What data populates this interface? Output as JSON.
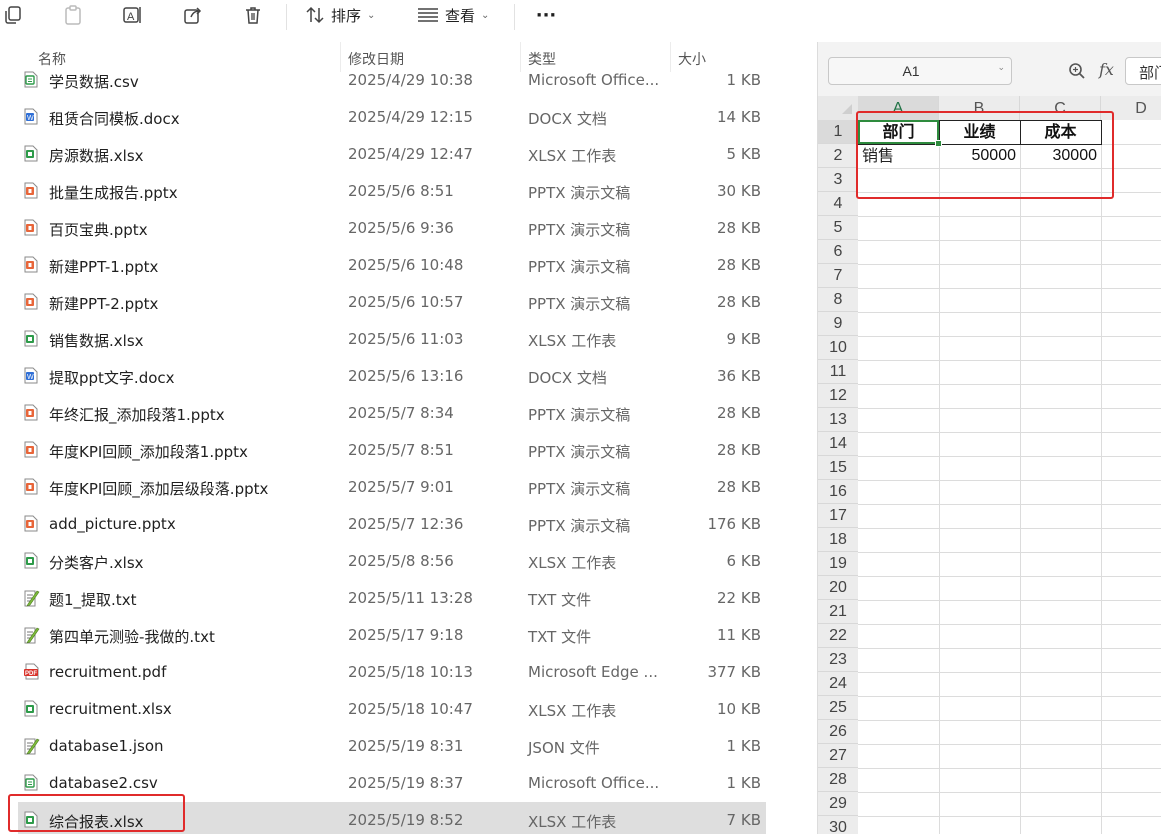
{
  "toolbar": {
    "sort_label": "排序",
    "view_label": "查看",
    "more_label": "···"
  },
  "file_list": {
    "columns": {
      "name": "名称",
      "modified": "修改日期",
      "type": "类型",
      "size": "大小"
    },
    "rows": [
      {
        "name": "学员数据.csv",
        "date": "2025/4/29 10:38",
        "type": "Microsoft Office...",
        "size": "1 KB",
        "icon": "csv-file-icon"
      },
      {
        "name": "租赁合同模板.docx",
        "date": "2025/4/29 12:15",
        "type": "DOCX 文档",
        "size": "14 KB",
        "icon": "docx-file-icon"
      },
      {
        "name": "房源数据.xlsx",
        "date": "2025/4/29 12:47",
        "type": "XLSX 工作表",
        "size": "5 KB",
        "icon": "xlsx-file-icon"
      },
      {
        "name": "批量生成报告.pptx",
        "date": "2025/5/6 8:51",
        "type": "PPTX 演示文稿",
        "size": "30 KB",
        "icon": "pptx-file-icon"
      },
      {
        "name": "百页宝典.pptx",
        "date": "2025/5/6 9:36",
        "type": "PPTX 演示文稿",
        "size": "28 KB",
        "icon": "pptx-file-icon"
      },
      {
        "name": "新建PPT-1.pptx",
        "date": "2025/5/6 10:48",
        "type": "PPTX 演示文稿",
        "size": "28 KB",
        "icon": "pptx-file-icon"
      },
      {
        "name": "新建PPT-2.pptx",
        "date": "2025/5/6 10:57",
        "type": "PPTX 演示文稿",
        "size": "28 KB",
        "icon": "pptx-file-icon"
      },
      {
        "name": "销售数据.xlsx",
        "date": "2025/5/6 11:03",
        "type": "XLSX 工作表",
        "size": "9 KB",
        "icon": "xlsx-file-icon"
      },
      {
        "name": "提取ppt文字.docx",
        "date": "2025/5/6 13:16",
        "type": "DOCX 文档",
        "size": "36 KB",
        "icon": "docx-file-icon"
      },
      {
        "name": "年终汇报_添加段落1.pptx",
        "date": "2025/5/7 8:34",
        "type": "PPTX 演示文稿",
        "size": "28 KB",
        "icon": "pptx-file-icon"
      },
      {
        "name": "年度KPI回顾_添加段落1.pptx",
        "date": "2025/5/7 8:51",
        "type": "PPTX 演示文稿",
        "size": "28 KB",
        "icon": "pptx-file-icon"
      },
      {
        "name": "年度KPI回顾_添加层级段落.pptx",
        "date": "2025/5/7 9:01",
        "type": "PPTX 演示文稿",
        "size": "28 KB",
        "icon": "pptx-file-icon"
      },
      {
        "name": "add_picture.pptx",
        "date": "2025/5/7 12:36",
        "type": "PPTX 演示文稿",
        "size": "176 KB",
        "icon": "pptx-file-icon"
      },
      {
        "name": "分类客户.xlsx",
        "date": "2025/5/8 8:56",
        "type": "XLSX 工作表",
        "size": "6 KB",
        "icon": "xlsx-file-icon"
      },
      {
        "name": "题1_提取.txt",
        "date": "2025/5/11 13:28",
        "type": "TXT 文件",
        "size": "22 KB",
        "icon": "txt-file-icon"
      },
      {
        "name": "第四单元测验-我做的.txt",
        "date": "2025/5/17 9:18",
        "type": "TXT 文件",
        "size": "11 KB",
        "icon": "txt-file-icon"
      },
      {
        "name": "recruitment.pdf",
        "date": "2025/5/18 10:13",
        "type": "Microsoft Edge ...",
        "size": "377 KB",
        "icon": "pdf-file-icon"
      },
      {
        "name": "recruitment.xlsx",
        "date": "2025/5/18 10:47",
        "type": "XLSX 工作表",
        "size": "10 KB",
        "icon": "xlsx-file-icon"
      },
      {
        "name": "database1.json",
        "date": "2025/5/19 8:31",
        "type": "JSON 文件",
        "size": "1 KB",
        "icon": "json-file-icon"
      },
      {
        "name": "database2.csv",
        "date": "2025/5/19 8:37",
        "type": "Microsoft Office...",
        "size": "1 KB",
        "icon": "csv-file-icon"
      },
      {
        "name": "综合报表.xlsx",
        "date": "2025/5/19 8:52",
        "type": "XLSX 工作表",
        "size": "7 KB",
        "icon": "xlsx-file-icon",
        "selected": true
      }
    ]
  },
  "spreadsheet": {
    "name_box": "A1",
    "fx_label": "fx",
    "formula_value": "部门",
    "columns": [
      "A",
      "B",
      "C",
      "D"
    ],
    "active_column": "A",
    "row_numbers": [
      "1",
      "2",
      "3",
      "4",
      "5",
      "6",
      "7",
      "8",
      "9",
      "10",
      "11",
      "12",
      "13",
      "14",
      "15",
      "16",
      "17",
      "18",
      "19",
      "20",
      "21",
      "22",
      "23",
      "24",
      "25",
      "26",
      "27",
      "28",
      "29",
      "30"
    ],
    "cells": {
      "A1": "部门",
      "B1": "业绩",
      "C1": "成本",
      "A2": "销售",
      "B2": "50000",
      "C2": "30000"
    }
  },
  "colors": {
    "highlight_red": "#e02b2b",
    "active_cell_green": "#2e8b3e",
    "xlsx_green": "#2e9b4a",
    "pptx_orange": "#e8663a",
    "docx_blue": "#2f6fd6"
  }
}
